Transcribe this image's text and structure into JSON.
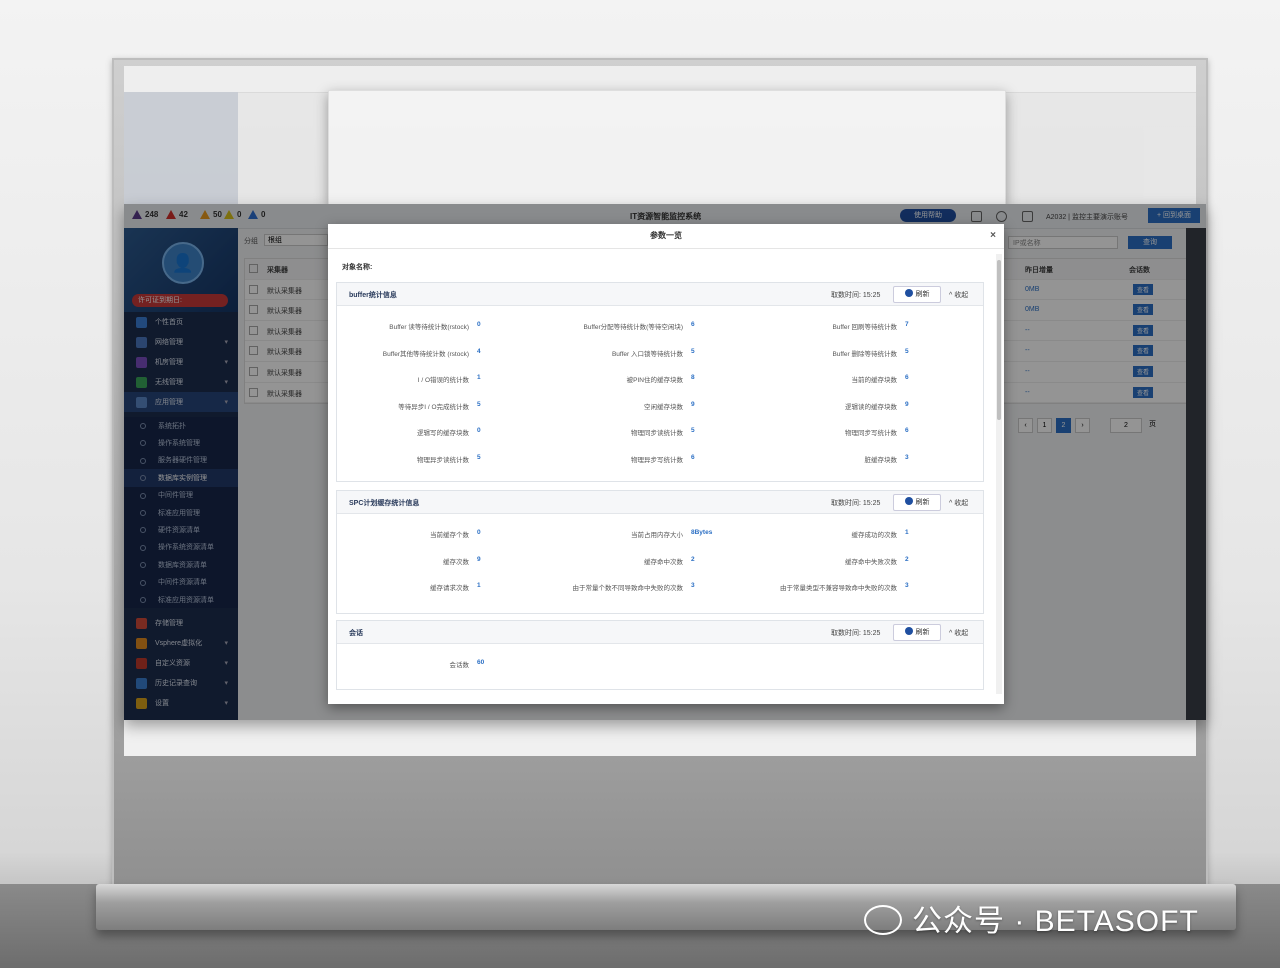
{
  "topbar": {
    "alerts": [
      {
        "level": "purple",
        "count": "248"
      },
      {
        "level": "red",
        "count": "42"
      },
      {
        "level": "orange",
        "count": "50"
      },
      {
        "level": "yellow",
        "count": "0"
      },
      {
        "level": "blue",
        "count": "0"
      }
    ],
    "system_title": "IT资源智能监控系统",
    "help_label": "使用帮助",
    "user_label": "A2032 | 监控主要演示账号",
    "back_label": "+ 回到桌面"
  },
  "sidebar": {
    "license_label": "许可证到期日:",
    "menu": [
      {
        "label": "个性首页",
        "color": "#3c7fd6"
      },
      {
        "label": "网络管理",
        "color": "#4a78c0"
      },
      {
        "label": "机房管理",
        "color": "#7a4fc2"
      },
      {
        "label": "无线管理",
        "color": "#3aa55a"
      },
      {
        "label": "应用管理",
        "color": "#5b87c7"
      }
    ],
    "submenu": [
      "系统拓扑",
      "操作系统管理",
      "服务器硬件管理",
      "数据库实例管理",
      "中间件管理",
      "标准应用管理",
      "硬件资源清单",
      "操作系统资源清单",
      "数据库资源清单",
      "中间件资源清单",
      "标准应用资源清单"
    ],
    "active_sub": "数据库实例管理",
    "menu_bottom": [
      {
        "label": "存储管理",
        "color": "#d04a3a"
      },
      {
        "label": "Vsphere虚拟化",
        "color": "#e08a20"
      },
      {
        "label": "自定义资源",
        "color": "#c0392b"
      },
      {
        "label": "历史记录查询",
        "color": "#3a7fd0"
      },
      {
        "label": "设置",
        "color": "#d9a21a"
      }
    ]
  },
  "content": {
    "filter_label": "分组",
    "filter_value": "根组",
    "search_placeholder": "IP或名称",
    "query_label": "查询",
    "table_header": {
      "col1": "采集器",
      "col2": "昨日增量",
      "col3": "会话数"
    },
    "rows": [
      {
        "col1": "默认采集器",
        "col2": "0MB",
        "col3": "查看"
      },
      {
        "col1": "默认采集器",
        "col2": "0MB",
        "col3": "查看"
      },
      {
        "col1": "默认采集器",
        "col2": "--",
        "col3": "查看"
      },
      {
        "col1": "默认采集器",
        "col2": "--",
        "col3": "查看"
      },
      {
        "col1": "默认采集器",
        "col2": "--",
        "col3": "查看"
      },
      {
        "col1": "默认采集器",
        "col2": "--",
        "col3": "查看"
      }
    ],
    "pager": {
      "pages": [
        "1",
        "2"
      ],
      "current": "2",
      "page_size": "2",
      "suffix": "页"
    }
  },
  "modal": {
    "title": "参数一览",
    "close_label": "×",
    "object_label": "对象名称:",
    "refresh_label": "刷新",
    "collapse_label": "^ 收起",
    "time_label": "取数时间: 15:25",
    "panels": [
      {
        "title": "buffer统计信息",
        "metrics": [
          {
            "label": "Buffer 读等待统计数(rstock)",
            "value": "0"
          },
          {
            "label": "Buffer分配等待统计数(等待空闲块)",
            "value": "6"
          },
          {
            "label": "Buffer 回刷等待统计数",
            "value": "7"
          },
          {
            "label": "Buffer其他等待统计数 (rstock)",
            "value": "4"
          },
          {
            "label": "Buffer 入口锁等待统计数",
            "value": "5"
          },
          {
            "label": "Buffer 删除等待统计数",
            "value": "5"
          },
          {
            "label": "I / O错误的统计数",
            "value": "1"
          },
          {
            "label": "被PIN住的缓存块数",
            "value": "8"
          },
          {
            "label": "当前的缓存块数",
            "value": "6"
          },
          {
            "label": "等待异步I / O完成统计数",
            "value": "5"
          },
          {
            "label": "空闲缓存块数",
            "value": "9"
          },
          {
            "label": "逻辑读的缓存块数",
            "value": "9"
          },
          {
            "label": "逻辑写的缓存块数",
            "value": "0"
          },
          {
            "label": "物理同步读统计数",
            "value": "5"
          },
          {
            "label": "物理同步写统计数",
            "value": "6"
          },
          {
            "label": "物理异步读统计数",
            "value": "5"
          },
          {
            "label": "物理异步写统计数",
            "value": "6"
          },
          {
            "label": "脏缓存块数",
            "value": "3"
          }
        ]
      },
      {
        "title": "SPC计划缓存统计信息",
        "metrics": [
          {
            "label": "当前缓存个数",
            "value": "0"
          },
          {
            "label": "当前占用内存大小",
            "value": "8Bytes"
          },
          {
            "label": "缓存成功的次数",
            "value": "1"
          },
          {
            "label": "缓存次数",
            "value": "9"
          },
          {
            "label": "缓存命中次数",
            "value": "2"
          },
          {
            "label": "缓存命中失败次数",
            "value": "2"
          },
          {
            "label": "缓存请求次数",
            "value": "1"
          },
          {
            "label": "由于常量个数不同导致命中失败的次数",
            "value": "3"
          },
          {
            "label": "由于常量类型不兼容导致命中失败的次数",
            "value": "3"
          }
        ]
      },
      {
        "title": "会话",
        "metrics": [
          {
            "label": "会话数",
            "value": "60"
          }
        ]
      }
    ]
  },
  "watermark": "公众号 · BETASOFT"
}
